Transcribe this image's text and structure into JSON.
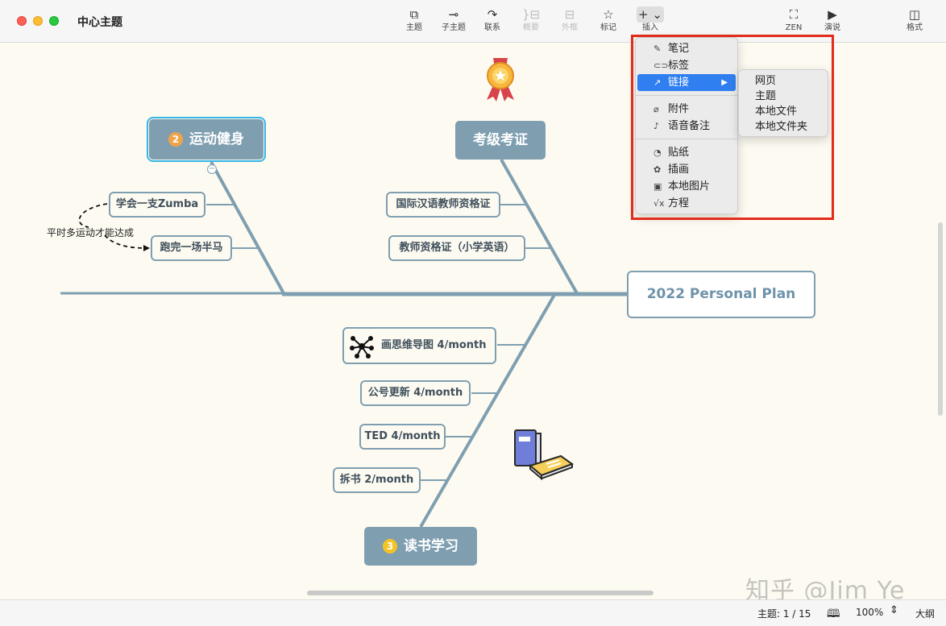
{
  "window": {
    "title": "中心主题"
  },
  "toolbar": {
    "topic": "主题",
    "subtopic": "子主题",
    "relationship": "联系",
    "summary": "概要",
    "boundary": "外框",
    "marker": "标记",
    "insert": "插入",
    "zen": "ZEN",
    "present": "演说",
    "format": "格式"
  },
  "map": {
    "root": "2022 Personal Plan",
    "branches": [
      {
        "badge": "2",
        "title": "运动健身",
        "badge_color": "#f1a34a",
        "children": [
          "学会一支Zumba",
          "跑完一场半马"
        ]
      },
      {
        "title": "考级考证",
        "children": [
          "国际汉语教师资格证",
          "教师资格证（小学英语）"
        ]
      },
      {
        "badge": "3",
        "title": "读书学习",
        "badge_color": "#f5c423",
        "children": [
          "画思维导图 4/month",
          "公号更新 4/month",
          "TED 4/month",
          "拆书 2/month"
        ]
      }
    ],
    "annotation": "平时多运动才能达成"
  },
  "insert_menu": {
    "items": [
      "笔记",
      "标签",
      "链接",
      "附件",
      "语音备注",
      "贴纸",
      "插画",
      "本地图片",
      "方程"
    ],
    "selected": "链接"
  },
  "link_submenu": {
    "items": [
      "网页",
      "主题",
      "本地文件",
      "本地文件夹"
    ]
  },
  "status": {
    "topic_count": "主题: 1 / 15",
    "zoom": "100%",
    "outline": "大纲"
  },
  "watermark": "知乎 @Jim Ye",
  "colors": {
    "branch": "#7f9fb1",
    "highlight": "#e22b1b",
    "menu_selected": "#2f7ff0",
    "canvas": "#fdfbf1"
  }
}
